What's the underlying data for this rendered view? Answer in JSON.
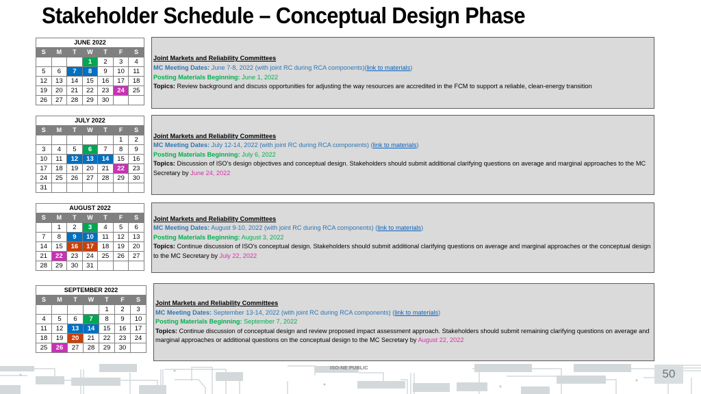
{
  "title": "Stakeholder Schedule – Conceptual Design Phase",
  "weekday_headers": [
    "S",
    "M",
    "T",
    "W",
    "T",
    "F",
    "S"
  ],
  "colors": {
    "posting_materials": "#00a651",
    "mc_meeting": "#0070c0",
    "question_deadline": "#c832b4",
    "other_highlight": "#c8410a",
    "calendar_header": "#808080",
    "box_background": "#dadada"
  },
  "calendars": [
    {
      "month": "JUNE 2022",
      "weeks": [
        [
          "",
          "",
          "",
          "1",
          "2",
          "3",
          "4"
        ],
        [
          "5",
          "6",
          "7",
          "8",
          "9",
          "10",
          "11"
        ],
        [
          "12",
          "13",
          "14",
          "15",
          "16",
          "17",
          "18"
        ],
        [
          "19",
          "20",
          "21",
          "22",
          "23",
          "24",
          "25"
        ],
        [
          "26",
          "27",
          "28",
          "29",
          "30",
          "",
          ""
        ]
      ],
      "highlights": {
        "1": "green",
        "7": "blue",
        "8": "blue",
        "24": "magenta"
      }
    },
    {
      "month": "JULY 2022",
      "weeks": [
        [
          "",
          "",
          "",
          "",
          "",
          "1",
          "2"
        ],
        [
          "3",
          "4",
          "5",
          "6",
          "7",
          "8",
          "9"
        ],
        [
          "10",
          "11",
          "12",
          "13",
          "14",
          "15",
          "16"
        ],
        [
          "17",
          "18",
          "19",
          "20",
          "21",
          "22",
          "23"
        ],
        [
          "24",
          "25",
          "26",
          "27",
          "28",
          "29",
          "30"
        ],
        [
          "31",
          "",
          "",
          "",
          "",
          "",
          ""
        ]
      ],
      "highlights": {
        "6": "green",
        "12": "blue",
        "13": "blue",
        "14": "blue",
        "22": "magenta"
      }
    },
    {
      "month": "AUGUST 2022",
      "weeks": [
        [
          "",
          "1",
          "2",
          "3",
          "4",
          "5",
          "6"
        ],
        [
          "7",
          "8",
          "9",
          "10",
          "11",
          "12",
          "13"
        ],
        [
          "14",
          "15",
          "16",
          "17",
          "18",
          "19",
          "20"
        ],
        [
          "21",
          "22",
          "23",
          "24",
          "25",
          "26",
          "27"
        ],
        [
          "28",
          "29",
          "30",
          "31",
          "",
          "",
          ""
        ]
      ],
      "highlights": {
        "3": "green",
        "9": "blue",
        "10": "blue",
        "16": "red",
        "17": "red",
        "22": "magenta"
      }
    },
    {
      "month": "SEPTEMBER 2022",
      "weeks": [
        [
          "",
          "",
          "",
          "",
          "1",
          "2",
          "3"
        ],
        [
          "4",
          "5",
          "6",
          "7",
          "8",
          "9",
          "10"
        ],
        [
          "11",
          "12",
          "13",
          "14",
          "15",
          "16",
          "17"
        ],
        [
          "18",
          "19",
          "20",
          "21",
          "22",
          "23",
          "24"
        ],
        [
          "25",
          "26",
          "27",
          "28",
          "29",
          "30",
          ""
        ]
      ],
      "highlights": {
        "7": "green",
        "13": "blue",
        "14": "blue",
        "20": "red",
        "26": "magenta"
      }
    }
  ],
  "boxes": [
    {
      "heading": "Joint Markets and Reliability Committees",
      "mc_label": "MC Meeting Dates:",
      "mc_text": " June 7-8, 2022 (with joint RC during RCA components)(",
      "link": "link to materials",
      "mc_close": ")",
      "post_label": "Posting Materials Beginning:",
      "post_text": " June 1, 2022",
      "topics_label": "Topics:",
      "topics_text": " Review background and discuss opportunities for adjusting the way resources are accredited in the FCM to support a reliable, clean-energy transition",
      "deadline": ""
    },
    {
      "heading": "Joint Markets and Reliability Committees",
      "mc_label": "MC Meeting Dates:",
      "mc_text": " July 12-14, 2022 (with joint RC during RCA components) (",
      "link": "link to materials",
      "mc_close": ")",
      "post_label": "Posting Materials Beginning:",
      "post_text": " July 6, 2022",
      "topics_label": "Topics:",
      "topics_text": " Discussion of ISO's design objectives and conceptual design. Stakeholders should submit additional clarifying questions on average and marginal approaches to the MC Secretary by ",
      "deadline": "June 24, 2022"
    },
    {
      "heading": "Joint Markets and Reliability Committees",
      "mc_label": "MC Meeting Dates:",
      "mc_text": " August 9-10, 2022 (with joint RC during RCA components) (",
      "link": "link to materials",
      "mc_close": ")",
      "post_label": "Posting Materials Beginning:",
      "post_text": " August 3, 2022",
      "topics_label": "Topics:",
      "topics_text": " Continue discussion of ISO's conceptual design. Stakeholders should submit additional clarifying questions on average and marginal approaches or the conceptual design to the MC Secretary by ",
      "deadline": "July 22, 2022"
    },
    {
      "heading": "Joint Markets and Reliability Committees",
      "mc_label": "MC Meeting Dates:",
      "mc_text": " September 13-14, 2022 (with joint RC during RCA components) (",
      "link": "link to materials",
      "mc_close": ")",
      "post_label": "Posting Materials Beginning:",
      "post_text": " September 7, 2022",
      "topics_label": "Topics:",
      "topics_text": " Continue discussion of conceptual design and review proposed impact assessment approach. Stakeholders should submit remaining clarifying questions on average and marginal approaches or additional questions on the conceptual design to the MC Secretary by ",
      "deadline": "August 22, 2022"
    }
  ],
  "footer": {
    "label": "ISO-NE PUBLIC",
    "page_number": "50",
    "decoration": "circuit-diagram-pattern"
  }
}
